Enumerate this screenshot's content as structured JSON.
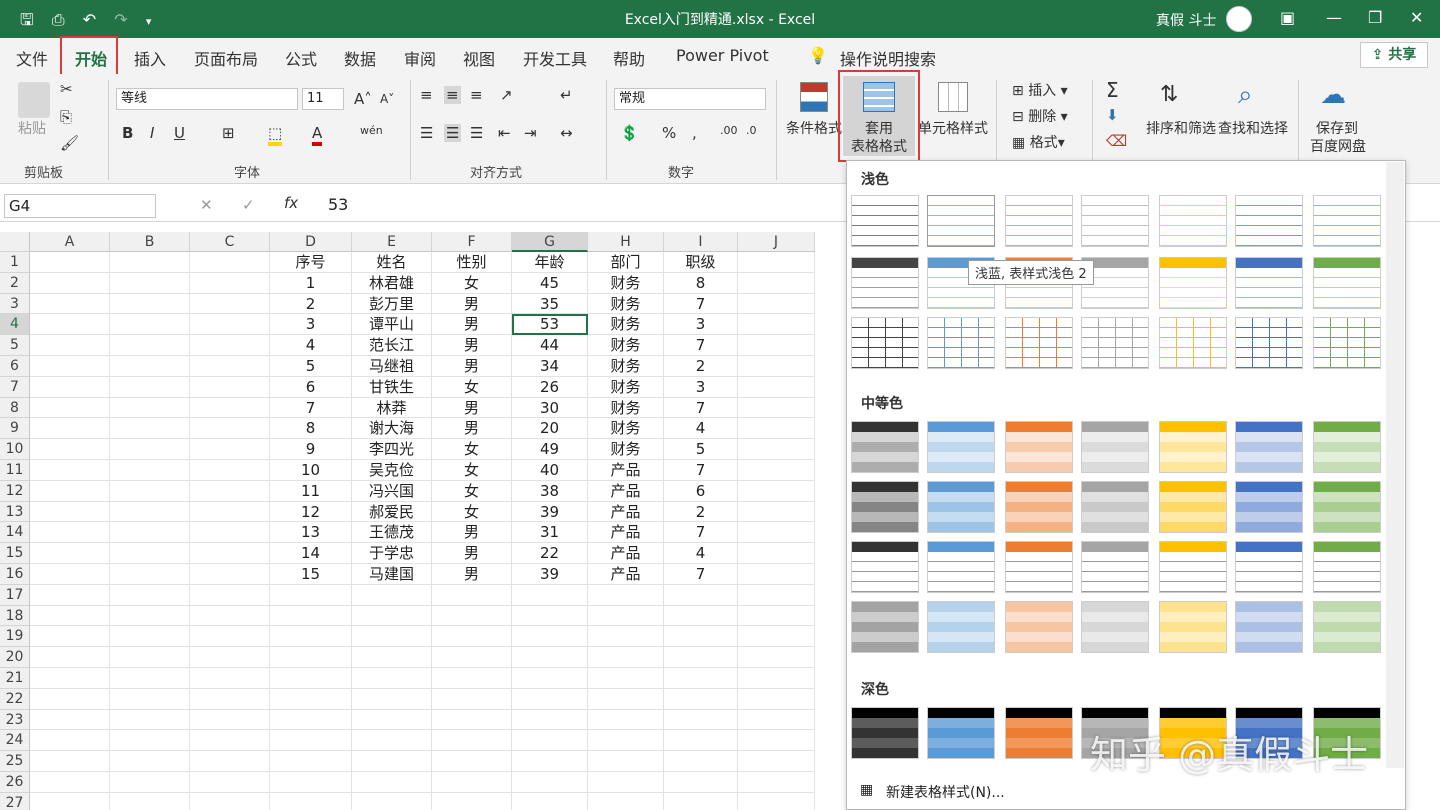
{
  "title": "Excel入门到精通.xlsx  -  Excel",
  "user": "真假 斗士",
  "tabs": [
    "文件",
    "开始",
    "插入",
    "页面布局",
    "公式",
    "数据",
    "审阅",
    "视图",
    "开发工具",
    "帮助",
    "Power Pivot"
  ],
  "tell_me": "操作说明搜索",
  "share_label": "共享",
  "ribbon": {
    "paste": "粘贴",
    "clipboard": "剪贴板",
    "font_name": "等线",
    "font_size": "11",
    "font_group": "字体",
    "align_group": "对齐方式",
    "number_format": "常规",
    "number_group": "数字",
    "conditional": "条件格式",
    "table_format_1": "套用",
    "table_format_2": "表格格式",
    "cell_style": "单元格样式",
    "insert": "插入",
    "delete": "删除",
    "format": "格式",
    "sort_filter": "排序和筛选",
    "find_select": "查找和选择",
    "save_1": "保存到",
    "save_2": "百度网盘"
  },
  "formula": {
    "name_box": "G4",
    "value": "53"
  },
  "columns": [
    "A",
    "B",
    "C",
    "D",
    "E",
    "F",
    "G",
    "H",
    "I",
    "J"
  ],
  "headers": [
    "序号",
    "姓名",
    "性别",
    "年龄",
    "部门",
    "职级"
  ],
  "rows": [
    [
      "1",
      "林君雄",
      "女",
      "45",
      "财务",
      "8"
    ],
    [
      "2",
      "彭万里",
      "男",
      "35",
      "财务",
      "7"
    ],
    [
      "3",
      "谭平山",
      "男",
      "53",
      "财务",
      "3"
    ],
    [
      "4",
      "范长江",
      "男",
      "44",
      "财务",
      "7"
    ],
    [
      "5",
      "马继祖",
      "男",
      "34",
      "财务",
      "2"
    ],
    [
      "6",
      "甘铁生",
      "女",
      "26",
      "财务",
      "3"
    ],
    [
      "7",
      "林莽",
      "男",
      "30",
      "财务",
      "7"
    ],
    [
      "8",
      "谢大海",
      "男",
      "20",
      "财务",
      "4"
    ],
    [
      "9",
      "李四光",
      "女",
      "49",
      "财务",
      "5"
    ],
    [
      "10",
      "吴克俭",
      "女",
      "40",
      "产品",
      "7"
    ],
    [
      "11",
      "冯兴国",
      "女",
      "38",
      "产品",
      "6"
    ],
    [
      "12",
      "郝爱民",
      "女",
      "39",
      "产品",
      "2"
    ],
    [
      "13",
      "王德茂",
      "男",
      "31",
      "产品",
      "7"
    ],
    [
      "14",
      "于学忠",
      "男",
      "22",
      "产品",
      "4"
    ],
    [
      "15",
      "马建国",
      "男",
      "39",
      "产品",
      "7"
    ]
  ],
  "row_numbers": [
    "1",
    "2",
    "3",
    "4",
    "5",
    "6",
    "7",
    "8",
    "9",
    "10",
    "11",
    "12",
    "13",
    "14",
    "15",
    "16",
    "17",
    "18",
    "19",
    "20",
    "21",
    "22",
    "23",
    "24",
    "25",
    "26",
    "27"
  ],
  "gallery": {
    "light": "浅色",
    "medium": "中等色",
    "dark": "深色",
    "tooltip": "浅蓝, 表样式浅色 2",
    "new_style": "新建表格样式(N)...",
    "palette": [
      "#555555",
      "#5b9bd5",
      "#ed7d31",
      "#a5a5a5",
      "#ffc000",
      "#4472c4",
      "#70ad47"
    ]
  },
  "watermark": "知乎 @真假斗士"
}
